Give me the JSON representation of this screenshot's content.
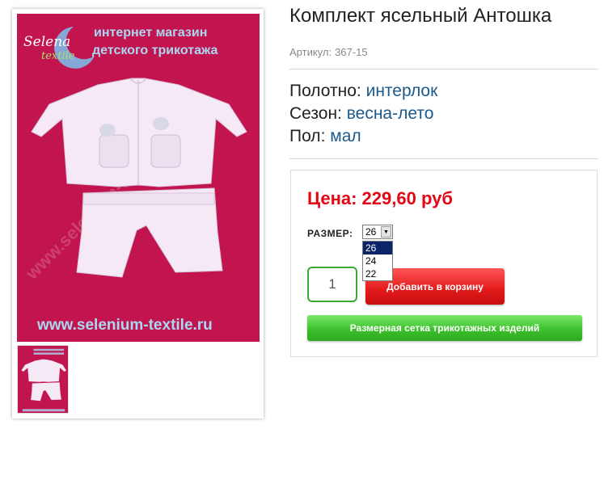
{
  "product": {
    "title": "Комплект ясельный Антошка",
    "sku_label": "Артикул:",
    "sku_value": "367-15"
  },
  "properties": [
    {
      "label": "Полотно:",
      "value": "интерлок"
    },
    {
      "label": "Сезон:",
      "value": "весна-лето"
    },
    {
      "label": "Пол:",
      "value": "мал"
    }
  ],
  "buy": {
    "price": "Цена: 229,60 руб",
    "size_label": "РАЗМЕР:",
    "size_selected": "26",
    "size_options": [
      "26",
      "24",
      "22"
    ],
    "quantity": "1",
    "add_to_cart": "Добавить в корзину",
    "size_chart": "Размерная сетка трикотажных изделий"
  },
  "image": {
    "brand_line1": "Selena",
    "brand_line2": "textile",
    "banner_line1": "интернет магазин",
    "banner_line2": "детского трикотажа",
    "watermark": "www.selenium-textile.ru",
    "footer_url": "www.selenium-textile.ru"
  },
  "colors": {
    "image_bg": "#c2154f",
    "price": "#e30613",
    "property_value": "#1d5a8c",
    "add_button": "#e21b1b",
    "size_chart_button": "#3ec12e"
  }
}
